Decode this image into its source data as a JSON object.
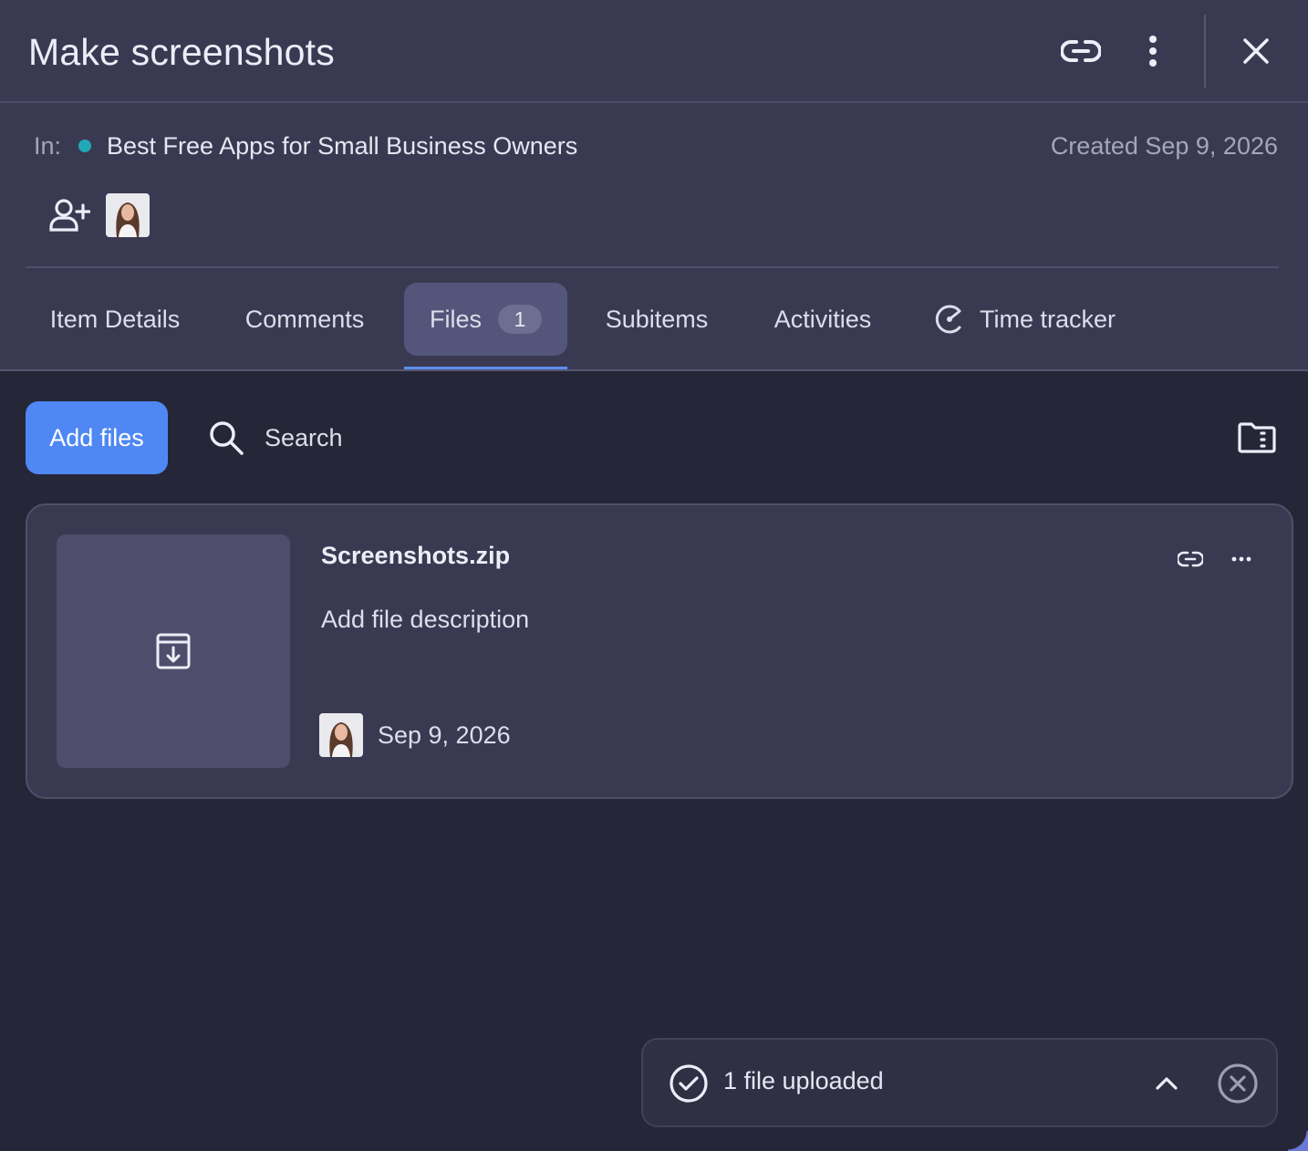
{
  "header": {
    "title": "Make screenshots",
    "in_label": "In:",
    "board_name": "Best Free Apps for Small Business Owners",
    "board_color": "#23a8b6",
    "created": "Created Sep 9, 2026",
    "icons": [
      "link-icon",
      "more-vertical-icon",
      "close-icon",
      "add-person-icon"
    ]
  },
  "tabs": [
    {
      "label": "Item Details"
    },
    {
      "label": "Comments"
    },
    {
      "label": "Files",
      "badge": "1",
      "active": true
    },
    {
      "label": "Subitems"
    },
    {
      "label": "Activities"
    },
    {
      "label": "Time tracker",
      "icon": "time-tracker-icon"
    }
  ],
  "toolbar": {
    "add_files_label": "Add files",
    "search_label": "Search",
    "accent_color": "#4f88f4"
  },
  "files": [
    {
      "name": "Screenshots.zip",
      "description_placeholder": "Add file description",
      "date": "Sep 9, 2026",
      "thumb_icon": "archive-download-icon"
    }
  ],
  "toast": {
    "text": "1 file uploaded",
    "icons": [
      "check-circle-icon",
      "chevron-up-icon",
      "close-circle-icon"
    ]
  }
}
